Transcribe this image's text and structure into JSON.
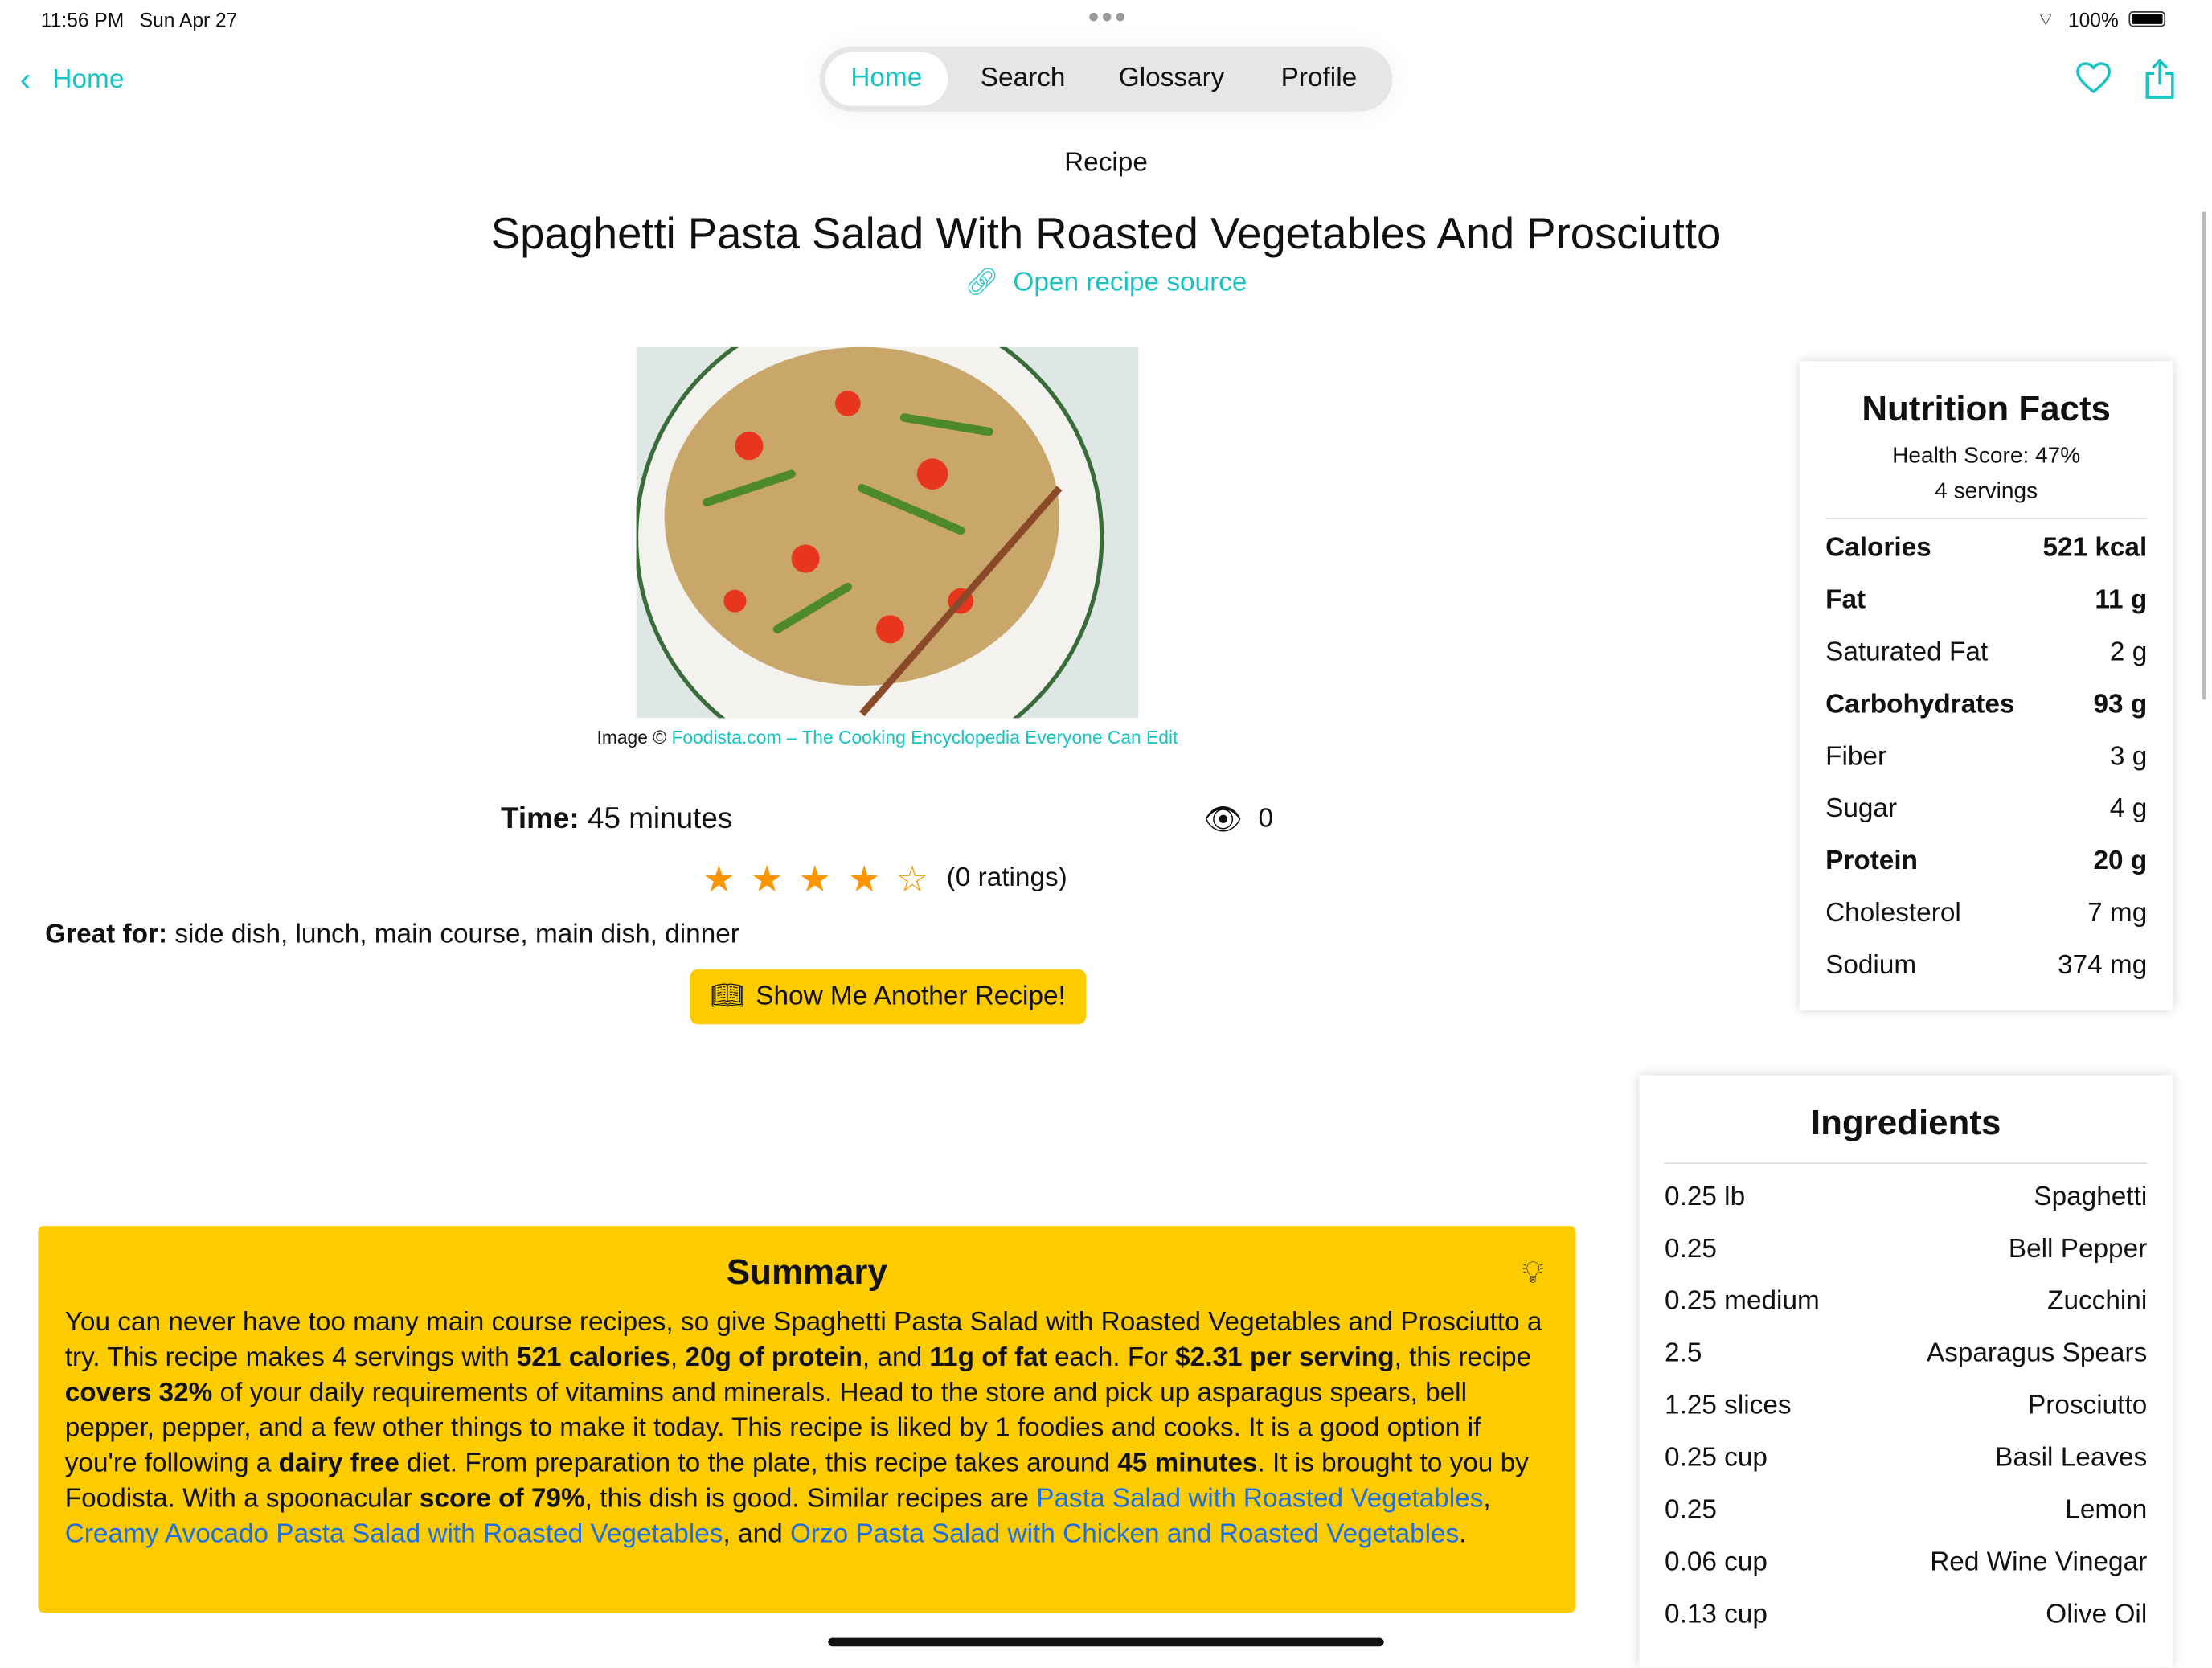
{
  "status_bar": {
    "time": "11:56 PM",
    "date": "Sun Apr 27",
    "battery": "100%"
  },
  "nav": {
    "back_label": "Home",
    "tabs": [
      "Home",
      "Search",
      "Glossary",
      "Profile"
    ],
    "active_tab": "Home"
  },
  "page": {
    "header": "Recipe",
    "title": "Spaghetti Pasta Salad With Roasted Vegetables And Prosciutto",
    "source_link": "Open recipe source",
    "image_credit_prefix": "Image ©",
    "image_credit_link": "Foodista.com – The Cooking Encyclopedia Everyone Can Edit",
    "time_label": "Time:",
    "time_value": "45 minutes",
    "views": "0",
    "rating_stars": 4,
    "rating_max": 5,
    "ratings_text": "(0 ratings)",
    "great_for_label": "Great for:",
    "great_for_value": "side dish, lunch, main course, main dish, dinner",
    "another_button": "Show Me Another Recipe!"
  },
  "nutrition": {
    "title": "Nutrition Facts",
    "health_score": "Health Score: 47%",
    "servings": "4 servings",
    "rows": [
      {
        "label": "Calories",
        "value": "521 kcal",
        "bold": true
      },
      {
        "label": "Fat",
        "value": "11 g",
        "bold": true
      },
      {
        "label": "Saturated Fat",
        "value": "2 g",
        "bold": false
      },
      {
        "label": "Carbohydrates",
        "value": "93 g",
        "bold": true
      },
      {
        "label": "Fiber",
        "value": "3 g",
        "bold": false
      },
      {
        "label": "Sugar",
        "value": "4 g",
        "bold": false
      },
      {
        "label": "Protein",
        "value": "20 g",
        "bold": true
      },
      {
        "label": "Cholesterol",
        "value": "7 mg",
        "bold": false
      },
      {
        "label": "Sodium",
        "value": "374 mg",
        "bold": false
      }
    ]
  },
  "ingredients": {
    "title": "Ingredients",
    "rows": [
      {
        "amount": "0.25 lb",
        "name": "Spaghetti"
      },
      {
        "amount": "0.25",
        "name": "Bell Pepper"
      },
      {
        "amount": "0.25 medium",
        "name": "Zucchini"
      },
      {
        "amount": "2.5",
        "name": "Asparagus Spears"
      },
      {
        "amount": "1.25 slices",
        "name": "Prosciutto"
      },
      {
        "amount": "0.25 cup",
        "name": "Basil Leaves"
      },
      {
        "amount": "0.25",
        "name": "Lemon"
      },
      {
        "amount": "0.06 cup",
        "name": "Red Wine Vinegar"
      },
      {
        "amount": "0.13 cup",
        "name": "Olive Oil"
      }
    ]
  },
  "summary": {
    "title": "Summary",
    "t1": "You can never have too many main course recipes, so give Spaghetti Pasta Salad with Roasted Vegetables and Prosciutto a try. This recipe makes 4 servings with ",
    "b1": "521 calories",
    "t2": ", ",
    "b2": "20g of protein",
    "t3": ", and ",
    "b3": "11g of fat",
    "t4": " each. For ",
    "b4": "$2.31 per serving",
    "t5": ", this recipe ",
    "b5": "covers 32%",
    "t6": " of your daily requirements of vitamins and minerals. Head to the store and pick up asparagus spears, bell pepper, pepper, and a few other things to make it today. This recipe is liked by 1 foodies and cooks. It is a good option if you're following a ",
    "b6": "dairy free",
    "t7": " diet. From preparation to the plate, this recipe takes around ",
    "b7": "45 minutes",
    "t8": ". It is brought to you by Foodista. With a spoonacular ",
    "b8": "score of 79%",
    "t9": ", this dish is good. Similar recipes are ",
    "l1": "Pasta Salad with Roasted Vegetables",
    "t10": ", ",
    "l2": "Creamy Avocado Pasta Salad with Roasted Vegetables",
    "t11": ", and ",
    "l3": "Orzo Pasta Salad with Chicken and Roasted Vegetables",
    "t12": "."
  },
  "colors": {
    "accent": "#19c3c3",
    "summary_bg": "#fccb00",
    "star": "#ff9500",
    "link": "#1f6fe0"
  }
}
